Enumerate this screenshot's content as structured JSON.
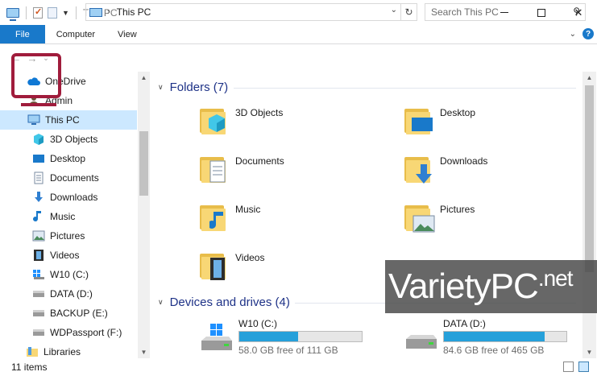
{
  "window": {
    "title": "This PC",
    "controls": {
      "minimize": "—",
      "maximize": "☐",
      "close": "✕"
    }
  },
  "ribbon": {
    "tabs": [
      "File",
      "Computer",
      "View"
    ],
    "expand": "⌄",
    "help": "?"
  },
  "nav": {
    "back": "←",
    "forward": "→",
    "recent": "⌄",
    "up": "↑",
    "crumb_sep": "›",
    "path": "This PC",
    "address_drop": "⌄",
    "refresh": "↻",
    "search_placeholder": "Search This PC",
    "search_icon": "⚲"
  },
  "sidebar": {
    "items": [
      {
        "label": "OneDrive",
        "icon": "cloud-icon"
      },
      {
        "label": "Admin",
        "icon": "user-icon"
      },
      {
        "label": "This PC",
        "icon": "computer-icon",
        "selected": true
      },
      {
        "label": "3D Objects",
        "icon": "cube-icon"
      },
      {
        "label": "Desktop",
        "icon": "desktop-icon"
      },
      {
        "label": "Documents",
        "icon": "documents-icon"
      },
      {
        "label": "Downloads",
        "icon": "download-arrow-icon"
      },
      {
        "label": "Music",
        "icon": "music-note-icon"
      },
      {
        "label": "Pictures",
        "icon": "picture-icon"
      },
      {
        "label": "Videos",
        "icon": "film-icon"
      },
      {
        "label": "W10 (C:)",
        "icon": "windows-drive-icon"
      },
      {
        "label": "DATA (D:)",
        "icon": "drive-icon"
      },
      {
        "label": "BACKUP (E:)",
        "icon": "drive-icon"
      },
      {
        "label": "WDPassport (F:)",
        "icon": "drive-icon"
      },
      {
        "label": "Libraries",
        "icon": "libraries-icon"
      }
    ]
  },
  "main": {
    "folders_header": "Folders (7)",
    "folders": [
      {
        "label": "3D Objects",
        "icon": "3d-objects-folder-icon"
      },
      {
        "label": "Desktop",
        "icon": "desktop-folder-icon"
      },
      {
        "label": "Documents",
        "icon": "documents-folder-icon"
      },
      {
        "label": "Downloads",
        "icon": "downloads-folder-icon"
      },
      {
        "label": "Music",
        "icon": "music-folder-icon"
      },
      {
        "label": "Pictures",
        "icon": "pictures-folder-icon"
      },
      {
        "label": "Videos",
        "icon": "videos-folder-icon"
      }
    ],
    "devices_header": "Devices and drives (4)",
    "drives": [
      {
        "label": "W10 (C:)",
        "free": "58.0 GB free of 111 GB",
        "used_fraction": 0.48,
        "icon": "windows-drive-icon"
      },
      {
        "label": "DATA (D:)",
        "free": "84.6 GB free of 465 GB",
        "used_fraction": 0.82,
        "icon": "hard-drive-icon"
      }
    ]
  },
  "status": {
    "items": "11 items"
  },
  "watermark": {
    "brand": "VarietyPC",
    "suffix": ".net"
  },
  "colors": {
    "accent": "#1979ca",
    "selection": "#cce8ff",
    "group_header": "#1e3287",
    "drive_fill": "#26a0da"
  }
}
